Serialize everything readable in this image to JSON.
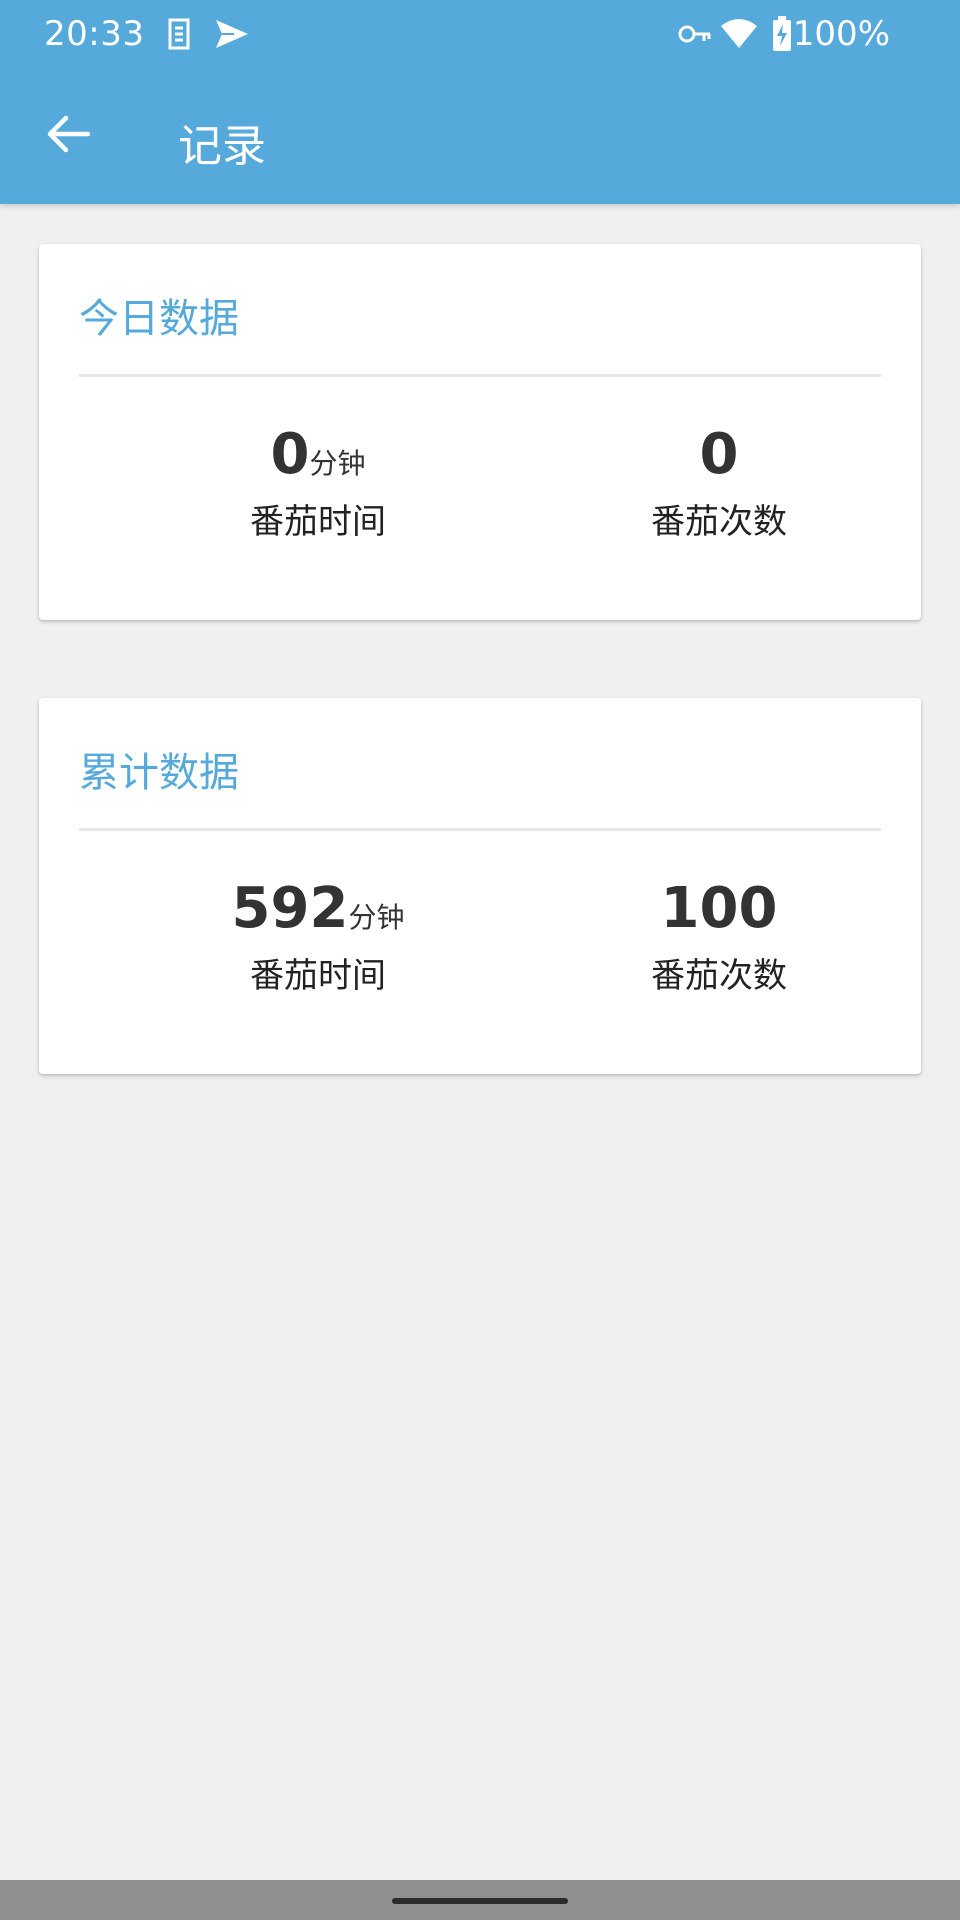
{
  "status_bar": {
    "time": "20:33",
    "battery_percent": "100%",
    "icons": [
      "sim-icon",
      "send-icon",
      "vpn-key-icon",
      "wifi-icon",
      "battery-charging-icon"
    ]
  },
  "toolbar": {
    "title": "记录",
    "back_icon": "arrow-back-icon"
  },
  "colors": {
    "accent": "#56aadb",
    "background": "#f0f0f0",
    "card": "#ffffff"
  },
  "cards": [
    {
      "title": "今日数据",
      "stats": [
        {
          "value": "0",
          "unit": "分钟",
          "label": "番茄时间"
        },
        {
          "value": "0",
          "unit": "",
          "label": "番茄次数"
        }
      ]
    },
    {
      "title": "累计数据",
      "stats": [
        {
          "value": "592",
          "unit": "分钟",
          "label": "番茄时间"
        },
        {
          "value": "100",
          "unit": "",
          "label": "番茄次数"
        }
      ]
    }
  ]
}
